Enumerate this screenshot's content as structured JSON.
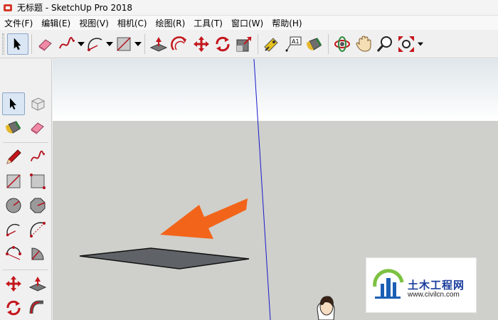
{
  "window": {
    "title": "无标题 - SketchUp Pro 2018"
  },
  "menu": [
    {
      "label": "文件(F)"
    },
    {
      "label": "编辑(E)"
    },
    {
      "label": "视图(V)"
    },
    {
      "label": "相机(C)"
    },
    {
      "label": "绘图(R)"
    },
    {
      "label": "工具(T)"
    },
    {
      "label": "窗口(W)"
    },
    {
      "label": "帮助(H)"
    }
  ],
  "toolbar_tools": [
    {
      "icon": "select-arrow-icon",
      "active": true
    },
    {
      "icon": "eraser-icon"
    },
    {
      "icon": "freehand-icon",
      "dropdown": true
    },
    {
      "icon": "arc-icon",
      "dropdown": true
    },
    {
      "icon": "rectangle-icon",
      "dropdown": true
    },
    {
      "icon": "push-pull-icon"
    },
    {
      "icon": "offset-icon"
    },
    {
      "icon": "move-icon"
    },
    {
      "icon": "rotate-icon"
    },
    {
      "icon": "scale-icon"
    },
    {
      "icon": "tape-measure-icon"
    },
    {
      "icon": "text-label-icon"
    },
    {
      "icon": "paint-bucket-icon"
    },
    {
      "icon": "orbit-icon"
    },
    {
      "icon": "pan-hand-icon"
    },
    {
      "icon": "zoom-icon"
    },
    {
      "icon": "zoom-extents-icon"
    }
  ],
  "text_tool_label": "A1",
  "left_tools": [
    "select-arrow-icon",
    "component-icon",
    "paint-bucket-icon",
    "eraser-icon",
    "pencil-line-icon",
    "freehand-icon",
    "rectangle-icon",
    "rotated-rectangle-icon",
    "circle-icon",
    "polygon-icon",
    "arc-icon",
    "two-point-arc-icon",
    "three-point-arc-icon",
    "pie-icon",
    "move-icon",
    "push-pull-icon",
    "rotate-icon",
    "follow-me-icon"
  ],
  "watermark": {
    "name": "土木工程网",
    "url": "www.civilcn.com"
  },
  "colors": {
    "arrow": "#f2641a",
    "face": "#5f6367",
    "axis_blue": "#1a1acc",
    "sky": "#ffffff",
    "ground": "#cfcfcb"
  }
}
